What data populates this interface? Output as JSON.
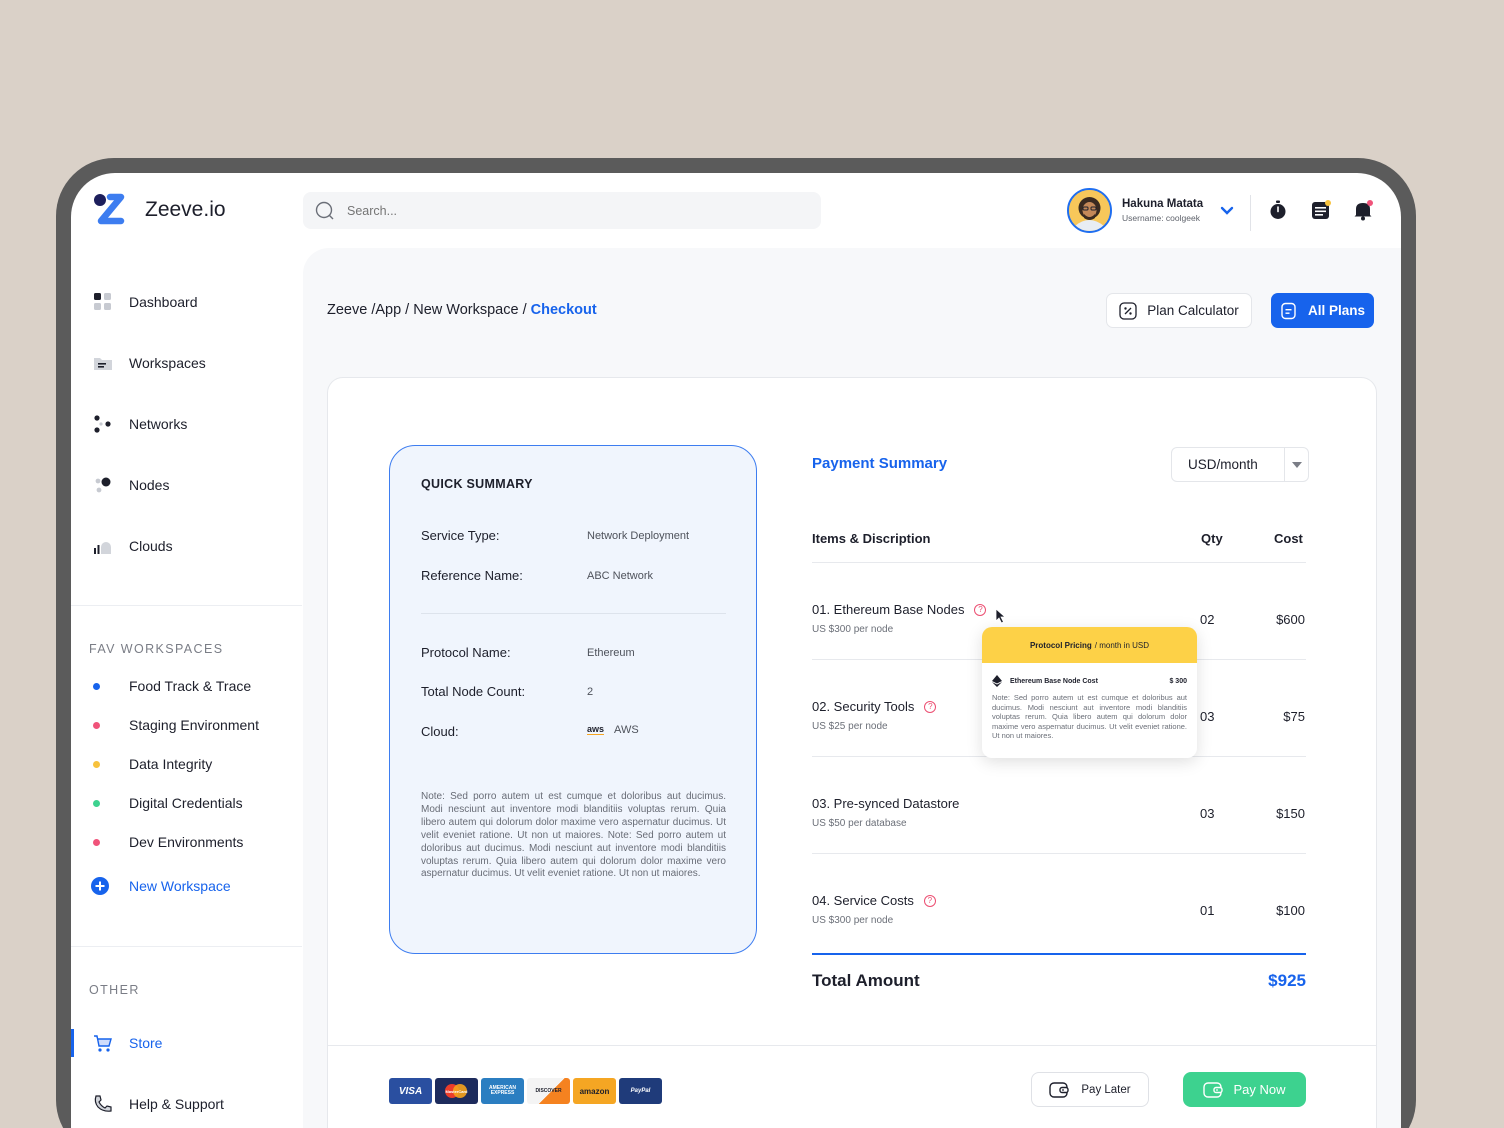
{
  "brand": {
    "name": "Zeeve.io"
  },
  "sidebar": {
    "nav": [
      {
        "label": "Dashboard",
        "icon": "dashboard-icon"
      },
      {
        "label": "Workspaces",
        "icon": "folder-icon"
      },
      {
        "label": "Networks",
        "icon": "network-icon"
      },
      {
        "label": "Nodes",
        "icon": "nodes-icon"
      },
      {
        "label": "Clouds",
        "icon": "cloud-icon"
      }
    ],
    "fav_label": "FAV WORKSPACES",
    "favs": [
      {
        "label": "Food Track & Trace",
        "color": "#1763ec"
      },
      {
        "label": "Staging Environment",
        "color": "#f0537a"
      },
      {
        "label": "Data Integrity",
        "color": "#f7c23d"
      },
      {
        "label": "Digital Credentials",
        "color": "#3dd28f"
      },
      {
        "label": "Dev Environments",
        "color": "#f0537a"
      }
    ],
    "new_workspace": "New Workspace",
    "other_label": "OTHER",
    "other": [
      {
        "label": "Store",
        "icon": "cart-icon",
        "active": true
      },
      {
        "label": "Help & Support",
        "icon": "phone-icon"
      }
    ]
  },
  "topbar": {
    "search_placeholder": "Search...",
    "user_name": "Hakuna Matata",
    "user_sub": "Username: coolgeek"
  },
  "breadcrumb": {
    "path": "Zeeve /App / New Workspace /",
    "current": "Checkout"
  },
  "actions": {
    "plan_calculator": "Plan Calculator",
    "all_plans": "All Plans"
  },
  "quick_summary": {
    "title": "QUICK SUMMARY",
    "service_type_label": "Service Type:",
    "service_type": "Network Deployment",
    "reference_label": "Reference Name:",
    "reference": "ABC Network",
    "protocol_label": "Protocol Name:",
    "protocol": "Ethereum",
    "node_count_label": "Total Node Count:",
    "node_count": "2",
    "cloud_label": "Cloud:",
    "cloud_logo": "aws",
    "cloud": "AWS",
    "note": "Note: Sed porro autem ut est cumque et doloribus aut ducimus. Modi nesciunt aut inventore modi blanditiis voluptas rerum. Quia libero autem qui dolorum dolor maxime vero aspernatur ducimus. Ut velit eveniet ratione. Ut non ut maiores. Note: Sed porro autem ut doloribus aut ducimus. Modi nesciunt aut inventore modi blanditiis voluptas rerum. Quia libero autem qui dolorum dolor maxime vero aspernatur ducimus. Ut velit eveniet ratione. Ut non ut maiores."
  },
  "payment_summary": {
    "title": "Payment Summary",
    "currency": "USD/month",
    "headers": {
      "items": "Items & Discription",
      "qty": "Qty",
      "cost": "Cost"
    },
    "items": [
      {
        "name": "01. Ethereum Base Nodes",
        "sub": "US $300 per node",
        "qty": "02",
        "cost": "$600",
        "help": true
      },
      {
        "name": "02. Security Tools",
        "sub": "US $25 per node",
        "qty": "03",
        "cost": "$75",
        "help": true
      },
      {
        "name": "03. Pre-synced Datastore",
        "sub": "US $50 per database",
        "qty": "03",
        "cost": "$150",
        "help": false
      },
      {
        "name": "04. Service Costs",
        "sub": "US $300 per node",
        "qty": "01",
        "cost": "$100",
        "help": true
      }
    ],
    "total_label": "Total Amount",
    "total": "$925"
  },
  "tooltip": {
    "title": "Protocol Pricing",
    "title_sub": "/ month in USD",
    "row_label": "Ethereum Base Node Cost",
    "row_value": "$ 300",
    "note": "Note: Sed porro autem ut est cumque et doloribus aut ducimus. Modi nesciunt aut inventore modi blanditiis voluptas rerum. Quia libero autem qui dolorum dolor maxime vero aspernatur ducimus. Ut velit eveniet ratione. Ut non ut maiores."
  },
  "payment_methods": [
    {
      "label": "VISA",
      "color": "#2a4fa0"
    },
    {
      "label": "MasterCard",
      "color": "#1d2b5c"
    },
    {
      "label": "AMERICAN EXPRESS",
      "color": "#2b7ec1"
    },
    {
      "label": "DISCOVER",
      "color": "#f2f2f2"
    },
    {
      "label": "amazon",
      "color": "#f5a623"
    },
    {
      "label": "PayPal",
      "color": "#1f3b7a"
    }
  ],
  "footer_buttons": {
    "pay_later": "Pay Later",
    "pay_now": "Pay Now"
  }
}
